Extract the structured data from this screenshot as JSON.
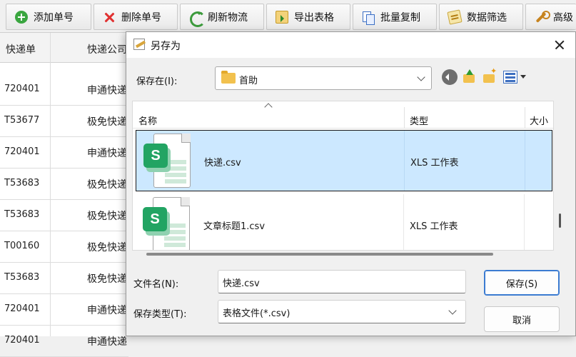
{
  "toolbar": {
    "buttons": [
      {
        "label": "添加单号",
        "icon": "plus-circle-icon"
      },
      {
        "label": "删除单号",
        "icon": "x-icon"
      },
      {
        "label": "刷新物流",
        "icon": "refresh-icon"
      },
      {
        "label": "导出表格",
        "icon": "export-icon"
      },
      {
        "label": "批量复制",
        "icon": "copy-icon"
      },
      {
        "label": "数据筛选",
        "icon": "filter-icon"
      },
      {
        "label": "高级",
        "icon": "wrench-icon"
      }
    ]
  },
  "background_table": {
    "headers": [
      "快递单",
      "快递公司"
    ],
    "rows": [
      {
        "tracking": "720401",
        "company": "申通快递"
      },
      {
        "tracking": "T53677",
        "company": "极免快递"
      },
      {
        "tracking": "720401",
        "company": "申通快递"
      },
      {
        "tracking": "T53683",
        "company": "极免快递"
      },
      {
        "tracking": "T53683",
        "company": "极免快递"
      },
      {
        "tracking": "T00160",
        "company": "极免快递"
      },
      {
        "tracking": "T53683",
        "company": "极免快递"
      },
      {
        "tracking": "720401",
        "company": "申通快递"
      },
      {
        "tracking": "720401",
        "company": "申通快递"
      }
    ]
  },
  "dialog": {
    "title": "另存为",
    "save_in_label": "保存在(I):",
    "save_in_value": "首助",
    "columns": {
      "name": "名称",
      "type": "类型",
      "size": "大小"
    },
    "files": [
      {
        "name": "快递.csv",
        "type": "XLS 工作表",
        "selected": true
      },
      {
        "name": "文章标题1.csv",
        "type": "XLS 工作表",
        "selected": false
      }
    ],
    "filename_label": "文件名(N):",
    "filename_value": "快递.csv",
    "filetype_label": "保存类型(T):",
    "filetype_value": "表格文件(*.csv)",
    "save_button": "保存(S)",
    "cancel_button": "取消"
  }
}
